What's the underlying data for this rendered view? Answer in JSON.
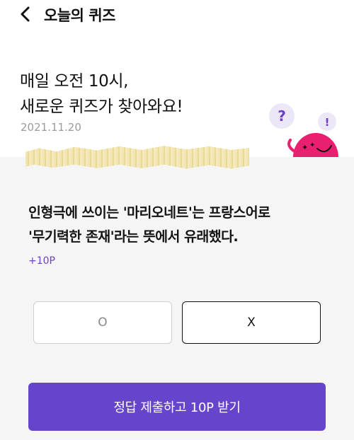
{
  "header": {
    "title": "오늘의 퀴즈",
    "back_icon": "chevron-left-icon"
  },
  "hero": {
    "line1": "매일 오전 10시,",
    "line2": "새로운 퀴즈가 찾아와요!",
    "date": "2021.11.20",
    "mascot_bubble_1": "?",
    "mascot_bubble_2": "!",
    "mascot_color": "#e8206f",
    "bubble_color": "#ece7f7"
  },
  "quiz": {
    "question_line1": "인형극에 쓰이는 '마리오네트'는 프랑스어로",
    "question_line2": "'무기력한 존재'라는 뜻에서 유래했다.",
    "points": "+10P",
    "option_o": "O",
    "option_x": "X",
    "selected": "X"
  },
  "submit": {
    "label": "정답 제출하고 10P 받기"
  },
  "colors": {
    "accent": "#6644cc",
    "points_text": "#6a40c8",
    "panel_bg": "#f5f5f5"
  }
}
